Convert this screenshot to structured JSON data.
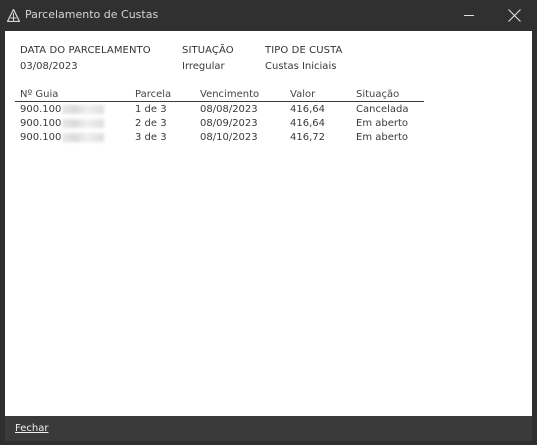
{
  "window": {
    "title": "Parcelamento de Custas"
  },
  "summary": {
    "data_label": "DATA DO PARCELAMENTO",
    "data_value": "03/08/2023",
    "situacao_label": "SITUAÇÃO",
    "situacao_value": "Irregular",
    "tipo_label": "TIPO DE CUSTA",
    "tipo_value": "Custas Iniciais"
  },
  "table": {
    "columns": [
      "Nº Guia",
      "Parcela",
      "Vencimento",
      "Valor",
      "Situação"
    ],
    "rows": [
      {
        "guia": "900.100",
        "parcela": "1 de 3",
        "vencimento": "08/08/2023",
        "valor": "416,64",
        "situacao": "Cancelada"
      },
      {
        "guia": "900.100",
        "parcela": "2 de 3",
        "vencimento": "08/09/2023",
        "valor": "416,64",
        "situacao": "Em aberto"
      },
      {
        "guia": "900.100",
        "parcela": "3 de 3",
        "vencimento": "08/10/2023",
        "valor": "416,72",
        "situacao": "Em aberto"
      }
    ]
  },
  "footer": {
    "close_label": "Fechar"
  },
  "colors": {
    "titlebar": "#303030",
    "footer": "#3a3a3a",
    "content_bg": "#ffffff"
  }
}
